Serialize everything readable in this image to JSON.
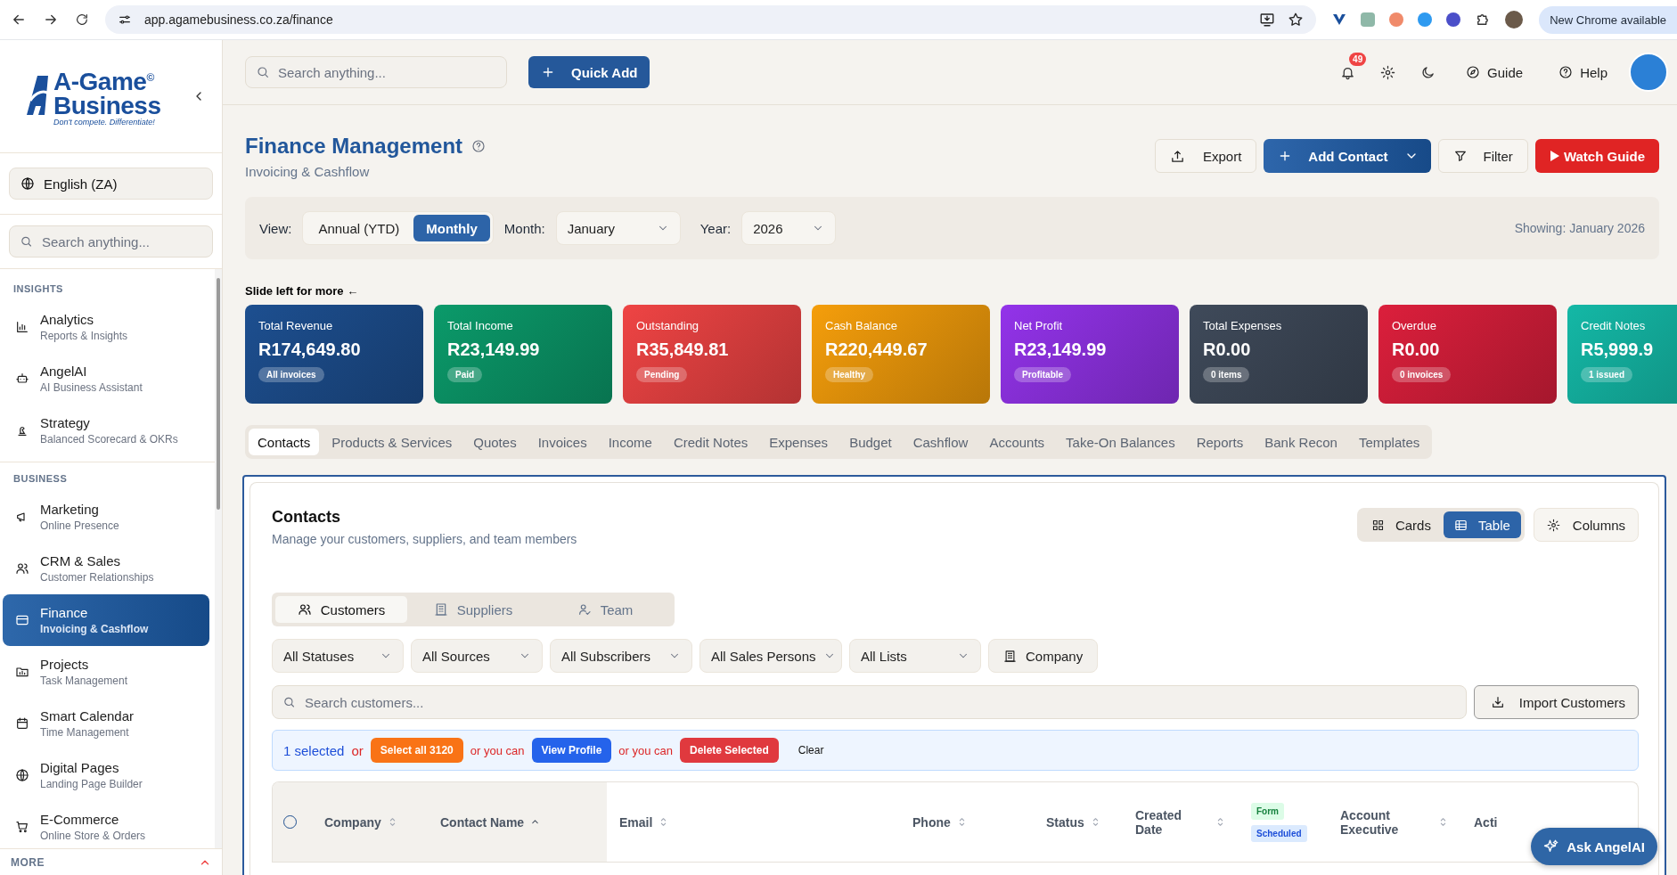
{
  "browser": {
    "url": "app.agamebusiness.co.za/finance",
    "update_label": "New Chrome available"
  },
  "header": {
    "search_placeholder": "Search anything...",
    "quick_add": "Quick Add",
    "notification_count": "49",
    "guide": "Guide",
    "help": "Help"
  },
  "sidebar": {
    "logo": {
      "line1": "A-Game",
      "line2": "Business",
      "mark": "©",
      "tagline": "Don't compete. Differentiate!"
    },
    "language": "English (ZA)",
    "search_placeholder": "Search anything...",
    "sections": [
      {
        "title": "INSIGHTS",
        "items": [
          {
            "title": "Analytics",
            "subtitle": "Reports & Insights",
            "selected": false
          },
          {
            "title": "AngelAI",
            "subtitle": "AI Business Assistant",
            "selected": false
          },
          {
            "title": "Strategy",
            "subtitle": "Balanced Scorecard & OKRs",
            "selected": false
          }
        ]
      },
      {
        "title": "BUSINESS",
        "items": [
          {
            "title": "Marketing",
            "subtitle": "Online Presence",
            "selected": false
          },
          {
            "title": "CRM & Sales",
            "subtitle": "Customer Relationships",
            "selected": false
          },
          {
            "title": "Finance",
            "subtitle": "Invoicing & Cashflow",
            "selected": true
          },
          {
            "title": "Projects",
            "subtitle": "Task Management",
            "selected": false
          },
          {
            "title": "Smart Calendar",
            "subtitle": "Time Management",
            "selected": false
          },
          {
            "title": "Digital Pages",
            "subtitle": "Landing Page Builder",
            "selected": false
          },
          {
            "title": "E-Commerce",
            "subtitle": "Online Store & Orders",
            "selected": false
          }
        ]
      }
    ],
    "more": "MORE"
  },
  "page": {
    "title": "Finance Management",
    "subtitle": "Invoicing & Cashflow",
    "export": "Export",
    "add_contact": "Add Contact",
    "filter": "Filter",
    "watch_guide": "Watch Guide"
  },
  "period": {
    "view_label": "View:",
    "view_options": [
      {
        "label": "Annual (YTD)",
        "selected": false
      },
      {
        "label": "Monthly",
        "selected": true
      }
    ],
    "month_label": "Month:",
    "month": "January",
    "year_label": "Year:",
    "year": "2026",
    "showing": "Showing: January 2026"
  },
  "slide_hint": "Slide left for more ←",
  "cards": [
    {
      "title": "Total Revenue",
      "value": "R174,649.80",
      "badge": "All invoices",
      "color": "#1d4f90"
    },
    {
      "title": "Total Income",
      "value": "R23,149.99",
      "badge": "Paid",
      "color": "#0b9a6a"
    },
    {
      "title": "Outstanding",
      "value": "R35,849.81",
      "badge": "Pending",
      "color": "#ef4444"
    },
    {
      "title": "Cash Balance",
      "value": "R220,449.67",
      "badge": "Healthy",
      "color": "#f59e0b"
    },
    {
      "title": "Net Profit",
      "value": "R23,149.99",
      "badge": "Profitable",
      "color": "#9333ea"
    },
    {
      "title": "Total Expenses",
      "value": "R0.00",
      "badge": "0 items",
      "color": "#3f4a5a"
    },
    {
      "title": "Overdue",
      "value": "R0.00",
      "badge": "0 invoices",
      "color": "#dc1f3c"
    },
    {
      "title": "Credit Notes",
      "value": "R5,999.9",
      "badge": "1 issued",
      "color": "#14b8a6"
    }
  ],
  "module_tabs": [
    {
      "label": "Contacts",
      "selected": true
    },
    {
      "label": "Products & Services",
      "selected": false
    },
    {
      "label": "Quotes",
      "selected": false
    },
    {
      "label": "Invoices",
      "selected": false
    },
    {
      "label": "Income",
      "selected": false
    },
    {
      "label": "Credit Notes",
      "selected": false
    },
    {
      "label": "Expenses",
      "selected": false
    },
    {
      "label": "Budget",
      "selected": false
    },
    {
      "label": "Cashflow",
      "selected": false
    },
    {
      "label": "Accounts",
      "selected": false
    },
    {
      "label": "Take-On Balances",
      "selected": false
    },
    {
      "label": "Reports",
      "selected": false
    },
    {
      "label": "Bank Recon",
      "selected": false
    },
    {
      "label": "Templates",
      "selected": false
    }
  ],
  "contacts": {
    "title": "Contacts",
    "description": "Manage your customers, suppliers, and team members",
    "view_toggle": [
      {
        "label": "Cards",
        "selected": false
      },
      {
        "label": "Table",
        "selected": true
      }
    ],
    "columns_button": "Columns",
    "type_tabs": [
      {
        "label": "Customers",
        "selected": true
      },
      {
        "label": "Suppliers",
        "selected": false
      },
      {
        "label": "Team",
        "selected": false
      }
    ],
    "filters": [
      "All Statuses",
      "All Sources",
      "All Subscribers",
      "All Sales Persons",
      "All Lists"
    ],
    "company_button": "Company",
    "search_placeholder": "Search customers...",
    "import_button": "Import Customers",
    "selection": [
      {
        "kind": "count",
        "text": "1 selected"
      },
      {
        "kind": "note",
        "text": "or"
      },
      {
        "kind": "action",
        "text": "Select all 3120",
        "color": "#f97316"
      },
      {
        "kind": "note",
        "text": "or you can"
      },
      {
        "kind": "action",
        "text": "View Profile",
        "color": "#2563eb"
      },
      {
        "kind": "note",
        "text": "or you can"
      },
      {
        "kind": "action",
        "text": "Delete Selected",
        "color": "#e0393e"
      },
      {
        "kind": "clear",
        "text": "Clear"
      }
    ],
    "table": {
      "select_all_checked": false,
      "columns": [
        {
          "kind": "text",
          "label": "Company",
          "sorted": false,
          "pinned": true
        },
        {
          "kind": "text",
          "label": "Contact Name",
          "sorted": true,
          "pinned": true
        },
        {
          "kind": "text",
          "label": "Email",
          "sorted": false,
          "pinned": false
        },
        {
          "kind": "text",
          "label": "Phone",
          "sorted": false,
          "pinned": false
        },
        {
          "kind": "text",
          "label": "Status",
          "sorted": false,
          "pinned": false
        },
        {
          "kind": "text",
          "label": "Created Date",
          "sorted": false,
          "pinned": false
        },
        {
          "kind": "badges",
          "badges": [
            {
              "text": "Form",
              "color": "#dcfce7"
            },
            {
              "text": "Scheduled",
              "color": "#dbeafe"
            }
          ],
          "pinned": false
        },
        {
          "kind": "text",
          "label": "Account Executive",
          "sorted": false,
          "pinned": false
        },
        {
          "kind": "cut",
          "label": "Acti",
          "pinned": false
        }
      ]
    }
  },
  "ask_button": "Ask AngelAI"
}
